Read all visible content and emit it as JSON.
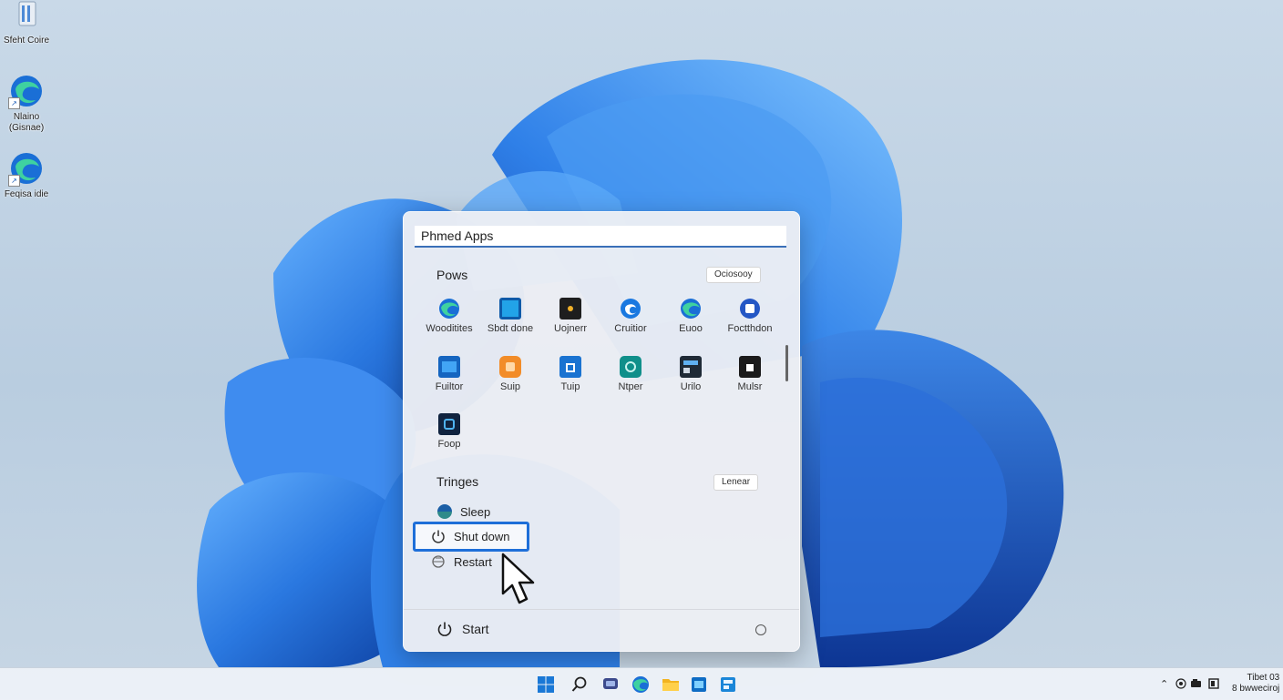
{
  "desktop": {
    "icons": [
      {
        "label": "Sfeht Coire",
        "icon": "recycle-bin-icon"
      },
      {
        "label": "Nlaino\n(Gisnae)",
        "icon": "edge-icon"
      },
      {
        "label": "Feqisa idie",
        "icon": "edge-icon"
      }
    ]
  },
  "start_menu": {
    "search_value": "Phmed Apps",
    "pinned": {
      "title": "Pows",
      "button": "Ociosooy",
      "apps": [
        {
          "name": "Wooditites",
          "icon": "edge-icon"
        },
        {
          "name": "Sbdt done",
          "icon": "monitor-icon"
        },
        {
          "name": "Uojnerr",
          "icon": "black-app-icon"
        },
        {
          "name": "Cruitior",
          "icon": "edge-icon"
        },
        {
          "name": "Euoo",
          "icon": "edge-icon"
        },
        {
          "name": "Foctthdon",
          "icon": "store-icon"
        },
        {
          "name": "Fuiltor",
          "icon": "folder-icon"
        },
        {
          "name": "Suip",
          "icon": "orange-app-icon"
        },
        {
          "name": "Tuip",
          "icon": "store-bag-icon"
        },
        {
          "name": "Ntper",
          "icon": "teal-app-icon"
        },
        {
          "name": "Urilo",
          "icon": "dark-window-icon"
        },
        {
          "name": "Mulsr",
          "icon": "black-bag-icon"
        },
        {
          "name": "Foop",
          "icon": "navy-app-icon"
        }
      ]
    },
    "settings": {
      "title": "Tringes",
      "button": "Lenear",
      "items": [
        {
          "label": "Sleep",
          "icon": "sleep-icon"
        },
        {
          "label": "Shut down",
          "icon": "power-icon"
        },
        {
          "label": "Restart",
          "icon": "restart-icon"
        }
      ]
    },
    "footer": {
      "label": "Start",
      "icon": "power-icon"
    }
  },
  "taskbar": {
    "icons": [
      "windows-start-icon",
      "search-icon",
      "chat-icon",
      "edge-icon",
      "file-explorer-icon",
      "store-icon",
      "app-icon"
    ],
    "clock_time": "Tibet 03",
    "clock_date": "8 bwweciroj"
  },
  "colors": {
    "accent": "#1e6fd9",
    "wallpaper_bg": "#c2d4e6",
    "bloom": "#2a78e0"
  }
}
